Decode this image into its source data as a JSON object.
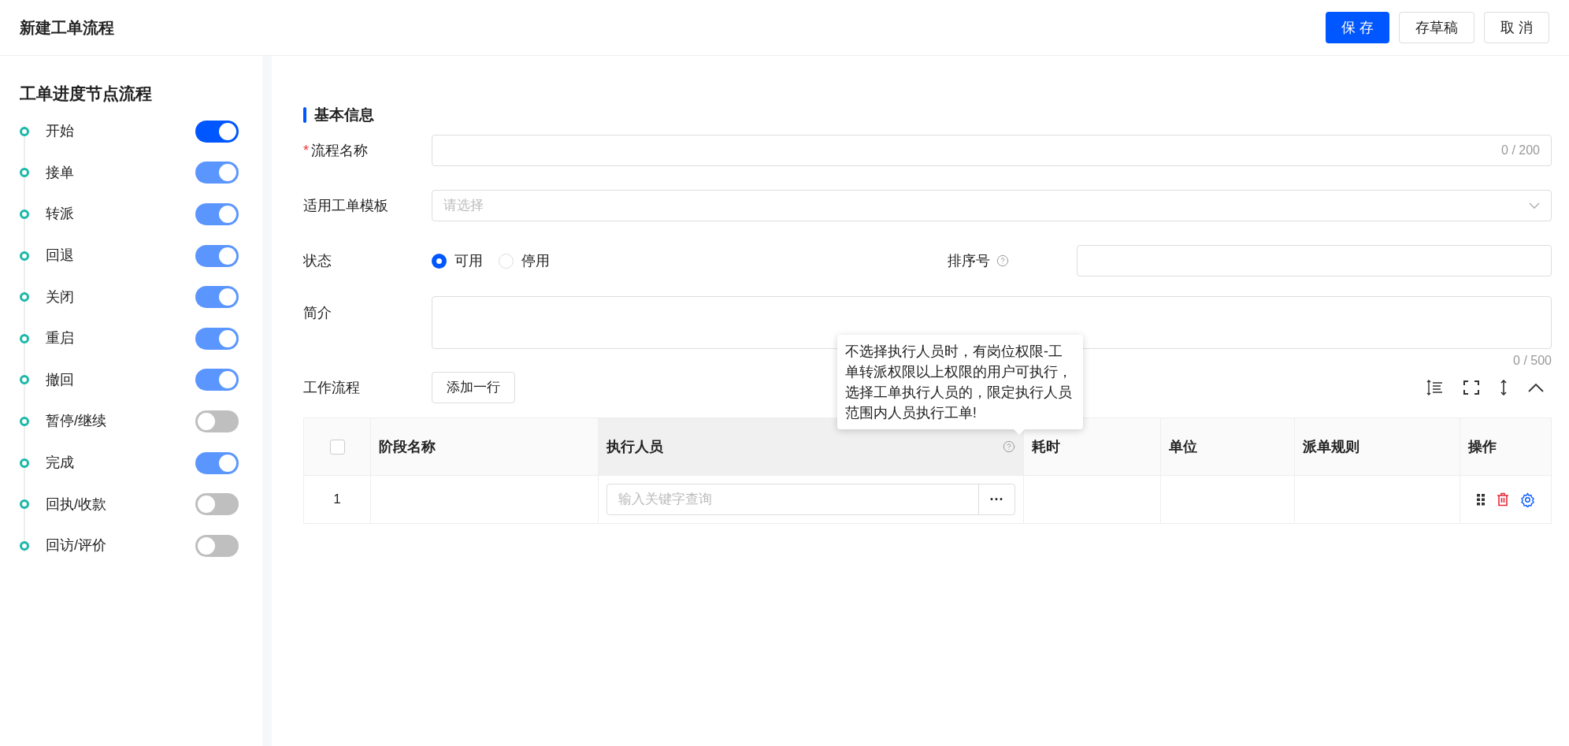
{
  "header": {
    "title": "新建工单流程",
    "buttons": [
      {
        "label": "保 存",
        "kind": "primary"
      },
      {
        "label": "存草稿",
        "kind": "default"
      },
      {
        "label": "取 消",
        "kind": "default"
      }
    ]
  },
  "sidebar": {
    "title": "工单进度节点流程",
    "nodes": [
      {
        "label": "开始",
        "on": true,
        "disabled": false
      },
      {
        "label": "接单",
        "on": true,
        "disabled": true
      },
      {
        "label": "转派",
        "on": true,
        "disabled": true
      },
      {
        "label": "回退",
        "on": true,
        "disabled": true
      },
      {
        "label": "关闭",
        "on": true,
        "disabled": true
      },
      {
        "label": "重启",
        "on": true,
        "disabled": true
      },
      {
        "label": "撤回",
        "on": true,
        "disabled": true
      },
      {
        "label": "暂停/继续",
        "on": false,
        "disabled": false
      },
      {
        "label": "完成",
        "on": true,
        "disabled": true
      },
      {
        "label": "回执/收款",
        "on": false,
        "disabled": false
      },
      {
        "label": "回访/评价",
        "on": false,
        "disabled": false
      }
    ]
  },
  "form": {
    "section_title": "基本信息",
    "name": {
      "label": "流程名称",
      "required_mark": "*",
      "counter": "0 / 200"
    },
    "template": {
      "label": "适用工单模板",
      "placeholder": "请选择"
    },
    "status": {
      "label": "状态",
      "options": [
        {
          "label": "可用",
          "selected": true
        },
        {
          "label": "停用",
          "selected": false
        }
      ]
    },
    "sort": {
      "label": "排序号"
    },
    "intro": {
      "label": "简介",
      "counter": "0 / 500"
    }
  },
  "workflow": {
    "label": "工作流程",
    "add_button": "添加一行",
    "select_all_checked": false,
    "columns": [
      {
        "label": "阶段名称",
        "help": false
      },
      {
        "label": "执行人员",
        "help": true
      },
      {
        "label": "耗时",
        "help": false
      },
      {
        "label": "单位",
        "help": false
      },
      {
        "label": "派单规则",
        "help": false
      },
      {
        "label": "操作",
        "help": false
      }
    ],
    "rows": [
      {
        "index": "1",
        "executor_placeholder": "输入关键字查询",
        "more": "···"
      }
    ],
    "tooltip": "不选择执行人员时，有岗位权限-工单转派权限以上权限的用户可执行，选择工单执行人员的，限定执行人员范围内人员执行工单!"
  }
}
